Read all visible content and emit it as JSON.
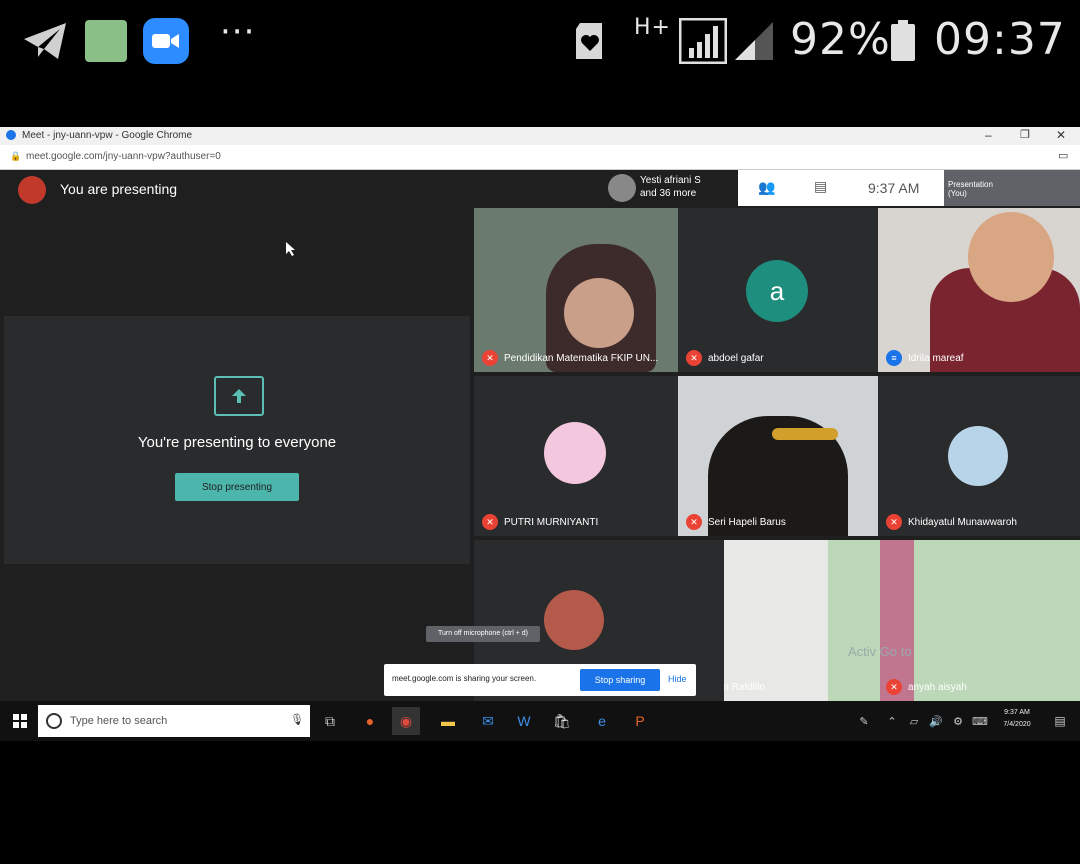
{
  "phone_status": {
    "network": "H+",
    "battery": "92%",
    "time": "09:37",
    "more": "···"
  },
  "chrome": {
    "window_title": "Meet - jny-uann-vpw - Google Chrome",
    "url": "meet.google.com/jny-uann-vpw?authuser=0"
  },
  "meet": {
    "presenting_label": "You are presenting",
    "participants_summary": "Yesti afriani S and 36 more",
    "clock": "9:37 AM",
    "presenting_title": "You're presenting to everyone",
    "stop_presenting": "Stop presenting",
    "avatar_letter": "a",
    "top_right_label": "Presentation (You)",
    "mute_tooltip": "Turn off microphone (ctrl + d)",
    "share_banner": {
      "text": "meet.google.com is sharing your screen.",
      "stop_button": "Stop sharing",
      "hide_button": "Hide"
    },
    "activate_watermark": "Activ Go to",
    "participants": [
      {
        "name": "Pendidikan Matematika FKIP UN..."
      },
      {
        "name": "abdoel gafar"
      },
      {
        "name": "Idrila mareaf"
      },
      {
        "name": "PUTRI MURNIYANTI"
      },
      {
        "name": "Seri Hapeli Barus"
      },
      {
        "name": "Khidayatul Munawwaroh"
      },
      {
        "name": ""
      },
      {
        "name": "Fikri Rafdillo"
      },
      {
        "name": "anyah aisyah"
      }
    ]
  },
  "taskbar": {
    "search_placeholder": "Type here to search",
    "time": "9:37 AM",
    "date": "7/4/2020"
  }
}
